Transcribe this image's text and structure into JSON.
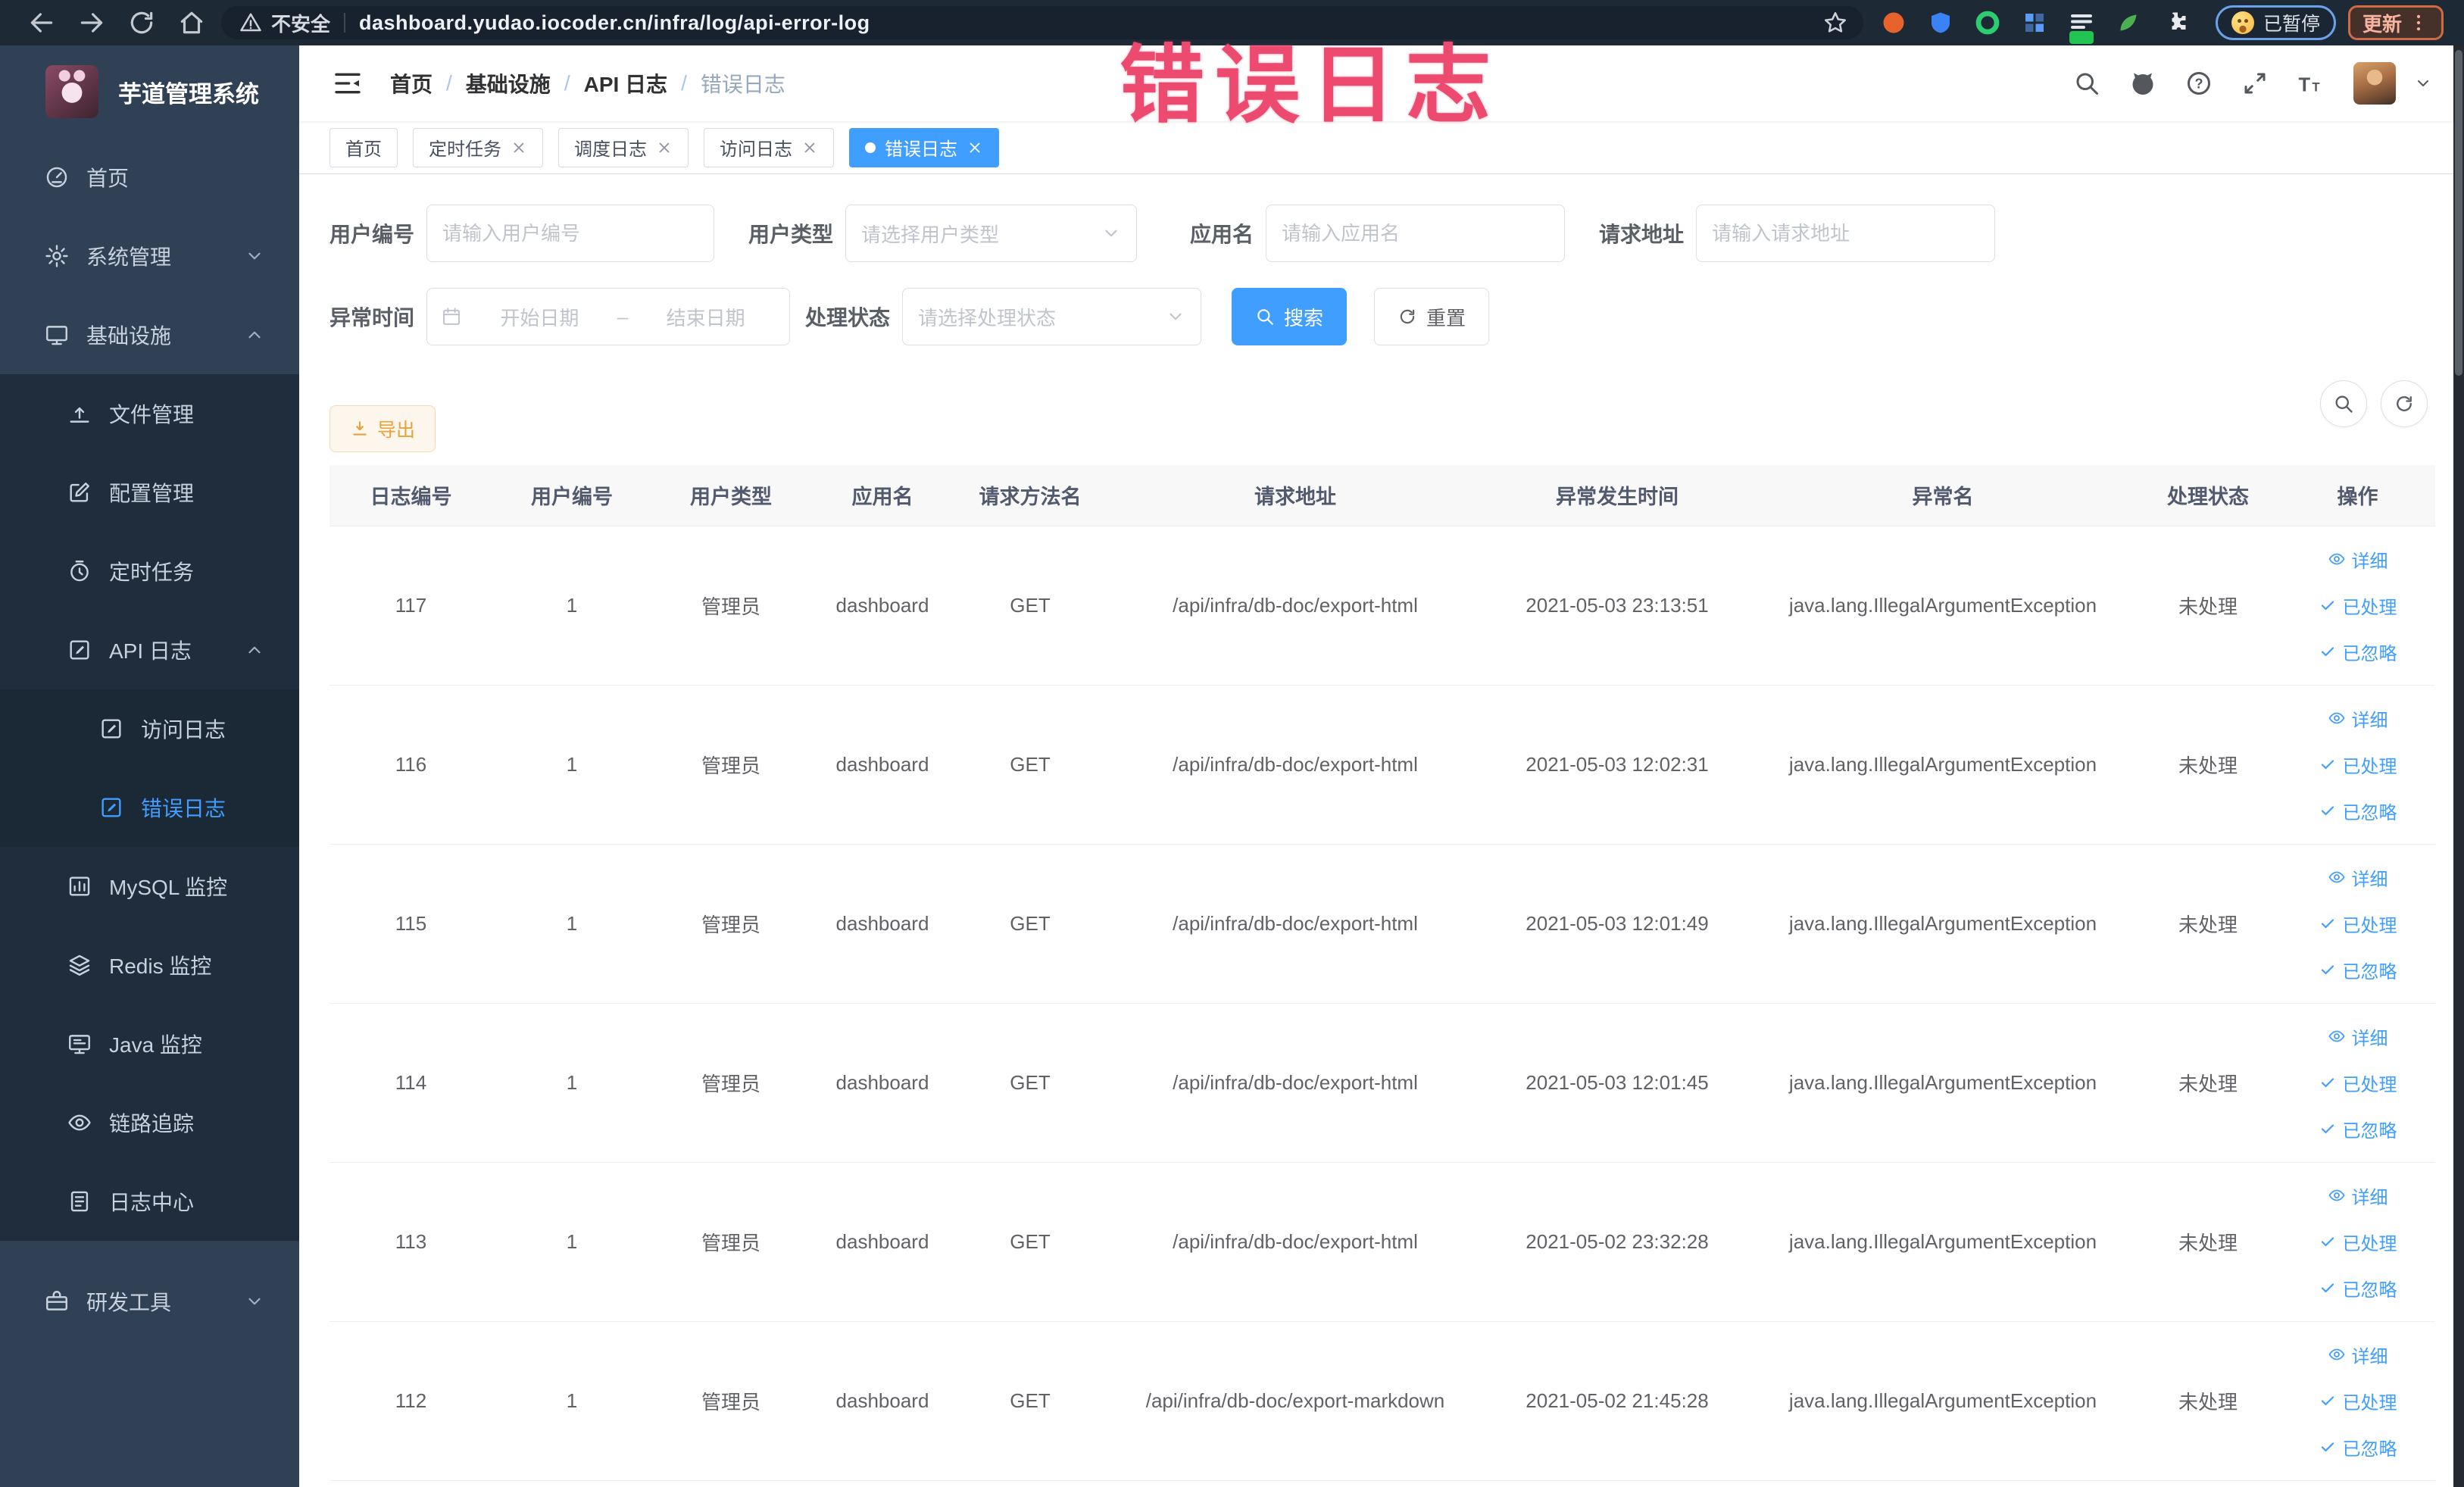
{
  "colors": {
    "accent": "#409eff",
    "warning": "#e6a23c",
    "annotation": "#ec4a6e",
    "sidebar_bg": "#304156",
    "submenu_bg": "#1f2d3d"
  },
  "annotation": {
    "text": "错误日志"
  },
  "browser": {
    "security_label": "不安全",
    "url": "dashboard.yudao.iocoder.cn/infra/log/api-error-log",
    "paused_label": "已暂停",
    "update_label": "更新",
    "nav_icons": [
      {
        "name": "back-icon",
        "icon": "back"
      },
      {
        "name": "forward-icon",
        "icon": "forward"
      },
      {
        "name": "reload-icon",
        "icon": "reload"
      },
      {
        "name": "home-icon",
        "icon": "home"
      }
    ],
    "extensions": [
      {
        "name": "ext-orange-icon",
        "icon": "circle-ext",
        "color": "#e8622c"
      },
      {
        "name": "ext-shield-icon",
        "icon": "shield-ext",
        "color": "#3b82f6"
      },
      {
        "name": "ext-green-ring-icon",
        "icon": "ring-ext",
        "color": "#2ecc71"
      },
      {
        "name": "ext-grid-icon",
        "icon": "grid-ext",
        "color": "#5b9cf8"
      },
      {
        "name": "ext-list-icon",
        "icon": "list-ext",
        "color": "#e3e6ea",
        "badge": "#23c552"
      },
      {
        "name": "ext-leaf-icon",
        "icon": "leaf-ext",
        "color": "#4caf50"
      },
      {
        "name": "ext-puzzle-icon",
        "icon": "puzzle-ext",
        "color": "#e8eaed"
      }
    ]
  },
  "sidebar": {
    "title": "芋道管理系统",
    "menu": [
      {
        "id": "home",
        "label": "首页",
        "icon": "dashboard-icon",
        "level": 0
      },
      {
        "id": "system-management",
        "label": "系统管理",
        "icon": "gear-icon",
        "level": 0,
        "chevron": "down"
      },
      {
        "id": "infrastructure",
        "label": "基础设施",
        "icon": "monitor-icon",
        "level": 0,
        "chevron": "up"
      },
      {
        "id": "file-management",
        "label": "文件管理",
        "icon": "upload-icon",
        "level": 1
      },
      {
        "id": "config-management",
        "label": "配置管理",
        "icon": "edit-icon",
        "level": 1
      },
      {
        "id": "scheduled-tasks",
        "label": "定时任务",
        "icon": "timer-icon",
        "level": 1
      },
      {
        "id": "api-log",
        "label": "API 日志",
        "icon": "log-icon",
        "level": 1,
        "chevron": "up"
      },
      {
        "id": "access-log",
        "label": "访问日志",
        "icon": "log-icon",
        "level": 2
      },
      {
        "id": "error-log",
        "label": "错误日志",
        "icon": "log-icon",
        "level": 2,
        "active": true
      },
      {
        "id": "mysql-monitor",
        "label": "MySQL 监控",
        "icon": "chart-icon",
        "level": 1
      },
      {
        "id": "redis-monitor",
        "label": "Redis 监控",
        "icon": "stack-icon",
        "level": 1
      },
      {
        "id": "java-monitor",
        "label": "Java 监控",
        "icon": "java-icon",
        "level": 1
      },
      {
        "id": "trace",
        "label": "链路追踪",
        "icon": "eye-icon",
        "level": 1
      },
      {
        "id": "log-center",
        "label": "日志中心",
        "icon": "doc-icon",
        "level": 1
      },
      {
        "id": "dev-tools",
        "label": "研发工具",
        "icon": "toolbox-icon",
        "level": 0,
        "chevron": "down"
      }
    ]
  },
  "header": {
    "breadcrumb": [
      "首页",
      "基础设施",
      "API 日志",
      "错误日志"
    ],
    "breadcrumb_separator": "/",
    "icons": [
      {
        "name": "search-icon",
        "icon": "search"
      },
      {
        "name": "github-icon",
        "icon": "github"
      },
      {
        "name": "help-icon",
        "icon": "question"
      },
      {
        "name": "fullscreen-icon",
        "icon": "fullscreen"
      },
      {
        "name": "font-size-icon",
        "icon": "font-size"
      }
    ]
  },
  "tabs": [
    {
      "label": "首页",
      "closable": false,
      "active": false
    },
    {
      "label": "定时任务",
      "closable": true,
      "active": false
    },
    {
      "label": "调度日志",
      "closable": true,
      "active": false
    },
    {
      "label": "访问日志",
      "closable": true,
      "active": false
    },
    {
      "label": "错误日志",
      "closable": true,
      "active": true
    }
  ],
  "filters": {
    "user_id": {
      "label": "用户编号",
      "placeholder": "请输入用户编号"
    },
    "user_type": {
      "label": "用户类型",
      "placeholder": "请选择用户类型"
    },
    "app_name": {
      "label": "应用名",
      "placeholder": "请输入应用名"
    },
    "request_url": {
      "label": "请求地址",
      "placeholder": "请输入请求地址"
    },
    "exception_time": {
      "label": "异常时间",
      "start_placeholder": "开始日期",
      "end_placeholder": "结束日期",
      "separator": "–"
    },
    "process_status": {
      "label": "处理状态",
      "placeholder": "请选择处理状态"
    },
    "search_label": "搜索",
    "reset_label": "重置"
  },
  "toolbar": {
    "export_label": "导出"
  },
  "table": {
    "headers": [
      "日志编号",
      "用户编号",
      "用户类型",
      "应用名",
      "请求方法名",
      "请求地址",
      "异常发生时间",
      "异常名",
      "处理状态",
      "操作"
    ],
    "actions": [
      {
        "label": "详细",
        "icon": "view-icon"
      },
      {
        "label": "已处理",
        "icon": "check-icon"
      },
      {
        "label": "已忽略",
        "icon": "check-icon"
      }
    ],
    "rows": [
      {
        "cells": [
          "117",
          "1",
          "管理员",
          "dashboard",
          "GET",
          "/api/infra/db-doc/export-html",
          "2021-05-03 23:13:51",
          "java.lang.IllegalArgumentException",
          "未处理"
        ]
      },
      {
        "cells": [
          "116",
          "1",
          "管理员",
          "dashboard",
          "GET",
          "/api/infra/db-doc/export-html",
          "2021-05-03 12:02:31",
          "java.lang.IllegalArgumentException",
          "未处理"
        ]
      },
      {
        "cells": [
          "115",
          "1",
          "管理员",
          "dashboard",
          "GET",
          "/api/infra/db-doc/export-html",
          "2021-05-03 12:01:49",
          "java.lang.IllegalArgumentException",
          "未处理"
        ]
      },
      {
        "cells": [
          "114",
          "1",
          "管理员",
          "dashboard",
          "GET",
          "/api/infra/db-doc/export-html",
          "2021-05-03 12:01:45",
          "java.lang.IllegalArgumentException",
          "未处理"
        ]
      },
      {
        "cells": [
          "113",
          "1",
          "管理员",
          "dashboard",
          "GET",
          "/api/infra/db-doc/export-html",
          "2021-05-02 23:32:28",
          "java.lang.IllegalArgumentException",
          "未处理"
        ]
      },
      {
        "cells": [
          "112",
          "1",
          "管理员",
          "dashboard",
          "GET",
          "/api/infra/db-doc/export-markdown",
          "2021-05-02 21:45:28",
          "java.lang.IllegalArgumentException",
          "未处理"
        ]
      }
    ]
  }
}
